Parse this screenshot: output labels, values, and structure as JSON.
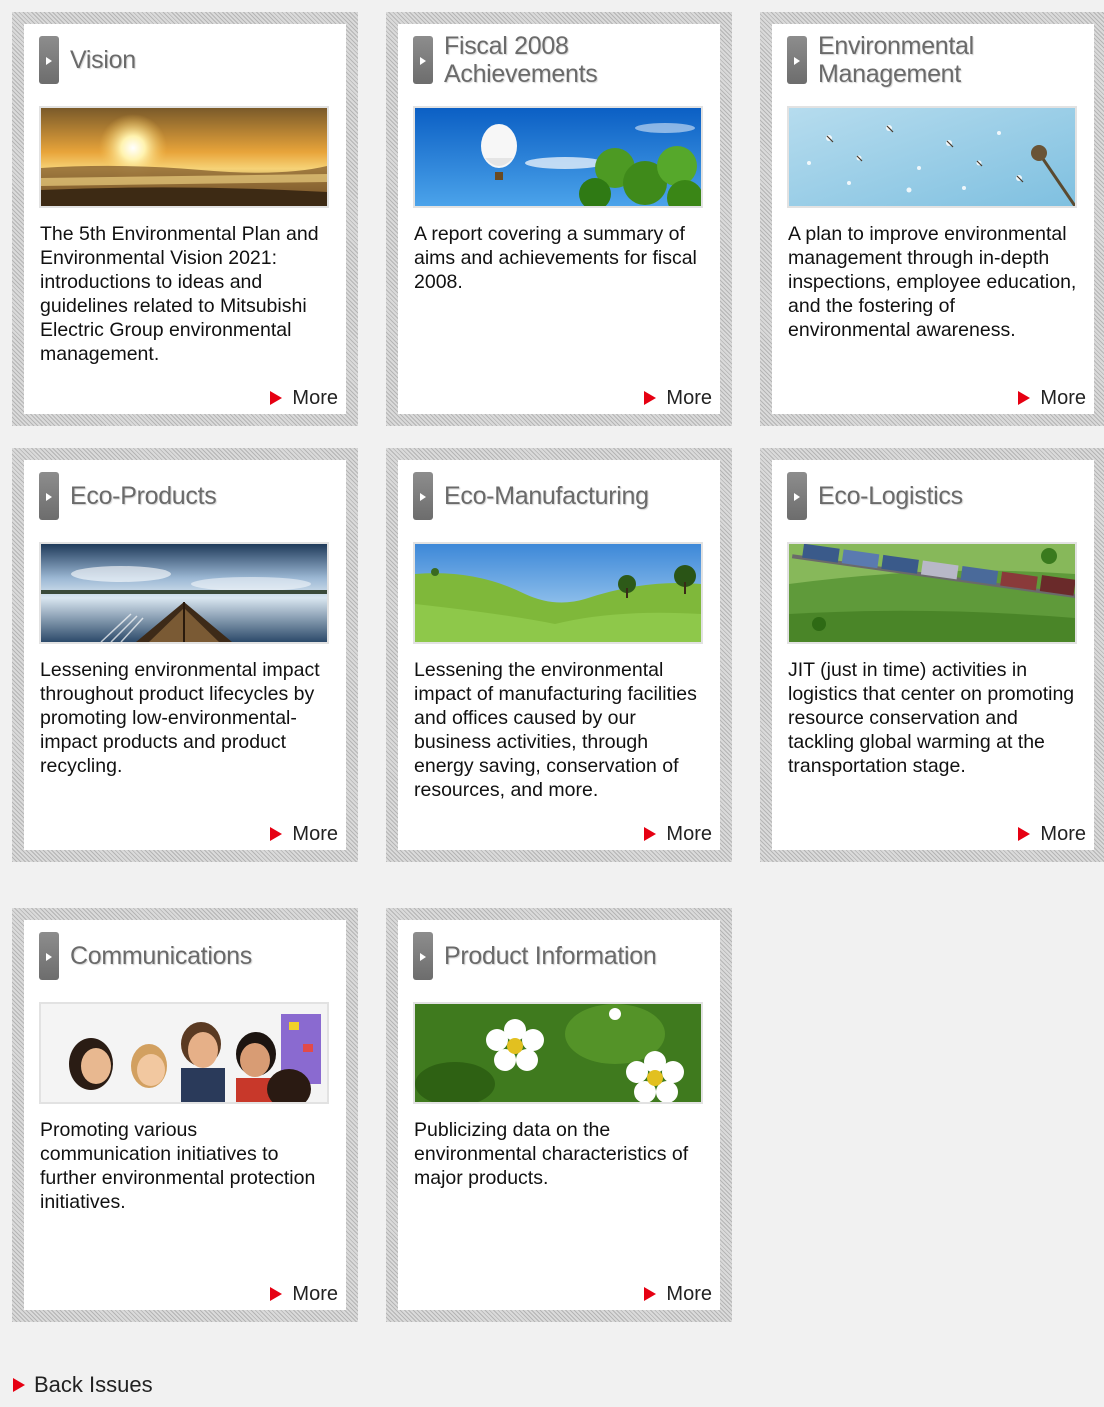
{
  "cards": [
    {
      "title": "Vision",
      "description": "The 5th Environmental Plan and Environmental Vision 2021: introductions to ideas and guidelines related to Mitsubishi Electric Group environmental management.",
      "more": "More",
      "image": "sunset-over-sea"
    },
    {
      "title": "Fiscal 2008 Achievements",
      "description": "A report covering a summary of aims and achievements for fiscal 2008.",
      "more": "More",
      "image": "hot-air-balloon-and-clover"
    },
    {
      "title": "Environmental Management",
      "description": "A plan to improve environmental management through in-depth inspections, employee education, and the fostering of environmental awareness.",
      "more": "More",
      "image": "dandelion-seeds-in-sky"
    },
    {
      "title": "Eco-Products",
      "description": "Lessening environmental impact throughout product lifecycles by promoting low-environmental-impact products and product recycling.",
      "more": "More",
      "image": "boat-on-lake"
    },
    {
      "title": "Eco-Manufacturing",
      "description": "Lessening the environmental impact of manufacturing facilities and offices caused by our business activities, through energy saving, conservation of resources, and more.",
      "more": "More",
      "image": "green-hills"
    },
    {
      "title": "Eco-Logistics",
      "description": "JIT (just in time) activities in logistics that center on promoting resource conservation and tackling global warming at the transportation stage.",
      "more": "More",
      "image": "freight-train"
    },
    {
      "title": "Communications",
      "description": "Promoting various communication initiatives to further environmental protection initiatives.",
      "more": "More",
      "image": "children-smiling"
    },
    {
      "title": "Product Information",
      "description": "Publicizing data on the environmental characteristics of major products.",
      "more": "More",
      "image": "white-flowers"
    }
  ],
  "back_issues": "Back Issues",
  "colors": {
    "accent_red": "#e60012",
    "title_gray": "#6a6a6a",
    "page_bg": "#f1f1f1"
  }
}
